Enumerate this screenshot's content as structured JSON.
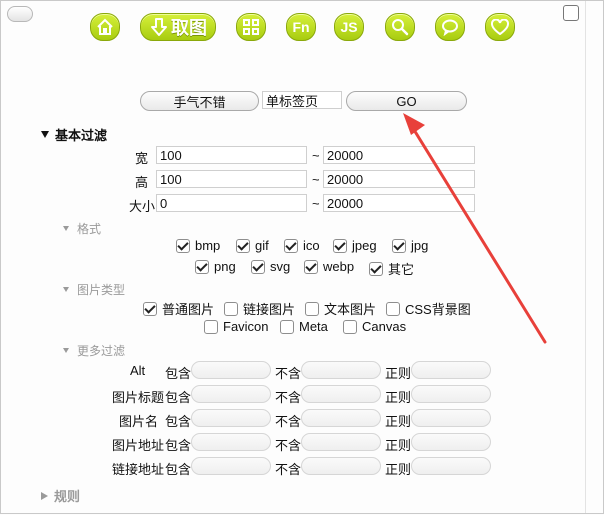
{
  "toolbar": {
    "fetch_label": "取图",
    "fn_label": "Fn",
    "js_label": "JS"
  },
  "top": {
    "keyword_button": "手气不错",
    "tab_value": "单标签页",
    "go_button": "GO"
  },
  "basic_filter": {
    "title": "基本过滤",
    "width": {
      "label": "宽",
      "min": "100",
      "sep": "~",
      "max": "20000"
    },
    "height": {
      "label": "高",
      "min": "100",
      "sep": "~",
      "max": "20000"
    },
    "size": {
      "label": "大小",
      "min": "0",
      "sep": "~",
      "max": "20000"
    }
  },
  "format": {
    "title": "格式",
    "items": [
      {
        "label": "bmp",
        "checked": true
      },
      {
        "label": "gif",
        "checked": true
      },
      {
        "label": "ico",
        "checked": true
      },
      {
        "label": "jpeg",
        "checked": true
      },
      {
        "label": "jpg",
        "checked": true
      },
      {
        "label": "png",
        "checked": true
      },
      {
        "label": "svg",
        "checked": true
      },
      {
        "label": "webp",
        "checked": true
      },
      {
        "label": "其它",
        "checked": true
      }
    ]
  },
  "image_type": {
    "title": "图片类型",
    "items": [
      {
        "label": "普通图片",
        "checked": true
      },
      {
        "label": "链接图片",
        "checked": false
      },
      {
        "label": "文本图片",
        "checked": false
      },
      {
        "label": "CSS背景图",
        "checked": false
      },
      {
        "label": "Favicon",
        "checked": false
      },
      {
        "label": "Meta",
        "checked": false
      },
      {
        "label": "Canvas",
        "checked": false
      }
    ]
  },
  "more_filter": {
    "title": "更多过滤",
    "include_label": "包含",
    "exclude_label": "不含",
    "regex_label": "正则",
    "rows": [
      {
        "label": "Alt",
        "has_include_label": false
      },
      {
        "label": "图片标题",
        "has_include_label": true
      },
      {
        "label": "图片名",
        "has_include_label": true
      },
      {
        "label": "图片地址",
        "has_include_label": true
      },
      {
        "label": "链接地址",
        "has_include_label": true
      }
    ]
  },
  "rules": {
    "title": "规则"
  },
  "colors": {
    "toolbar_green": "#b4d61a",
    "arrow_red": "#e8403a"
  }
}
